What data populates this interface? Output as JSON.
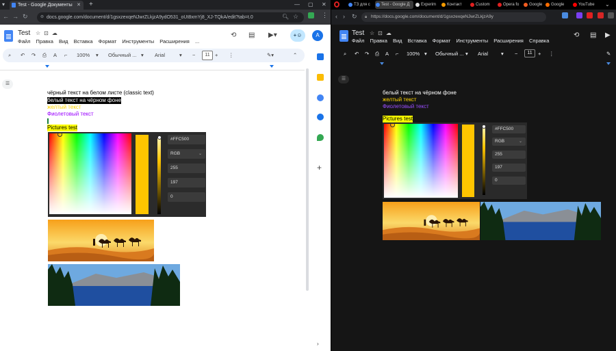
{
  "left": {
    "tab_title": "Test - Google Документы",
    "url": "docs.google.com/document/d/1gsxzexqeNJwrZLkjzA9ydO531_oUt8xmYj8_XJ-TQkA/edit?tab=t.0",
    "doc_title": "Test",
    "menu": [
      "Файл",
      "Правка",
      "Вид",
      "Вставка",
      "Формат",
      "Инструменты",
      "Расширения",
      "..."
    ],
    "avatar": "A",
    "zoom": "100%",
    "style": "Обычный ...",
    "font": "Arial",
    "font_size": "11",
    "lines": [
      {
        "text": "чёрный текст на белом листе (classic text)",
        "color": "#000000",
        "bg": ""
      },
      {
        "text": "белый текст на чёрном фоне",
        "color": "#ffffff",
        "bg": "#000000"
      },
      {
        "text": "желтый текст",
        "color": "#ffd600",
        "bg": ""
      },
      {
        "text": "Фиолетовый текст",
        "color": "#9900ff",
        "bg": ""
      },
      {
        "text": "Pictures test",
        "color": "#000000",
        "bg": "#ffff00"
      }
    ],
    "picker": {
      "hex": "#FFC500",
      "mode": "RGB",
      "r": "255",
      "g": "197",
      "b": "0"
    }
  },
  "right": {
    "tabs": [
      "ТЗ для с",
      "Test - Google Д",
      "Experim",
      "Контакт",
      "Custom",
      "Opera fo",
      "Google",
      "Google",
      "YouTube"
    ],
    "url": "https://docs.google.com/document/d/1gsxzexqeNJwrZLkjzA9y",
    "doc_title": "Test",
    "menu": [
      "Файл",
      "Правка",
      "Вид",
      "Вставка",
      "Формат",
      "Инструменты",
      "Расширения",
      "Справка"
    ],
    "avatar": "A",
    "zoom": "100%",
    "style": "Обычный ...",
    "font": "Arial",
    "font_size": "11",
    "lines": [
      {
        "text": "белый текст на чёрном фоне",
        "color": "#ffffff",
        "bg": ""
      },
      {
        "text": "желтый текст",
        "color": "#ffd600",
        "bg": ""
      },
      {
        "text": "Фиолетовый текст",
        "color": "#9a4dff",
        "bg": ""
      }
    ],
    "pictures_label": "Pictures test",
    "picker": {
      "hex": "#FFC500",
      "mode": "RGB",
      "r": "255",
      "g": "197",
      "b": "0"
    }
  }
}
